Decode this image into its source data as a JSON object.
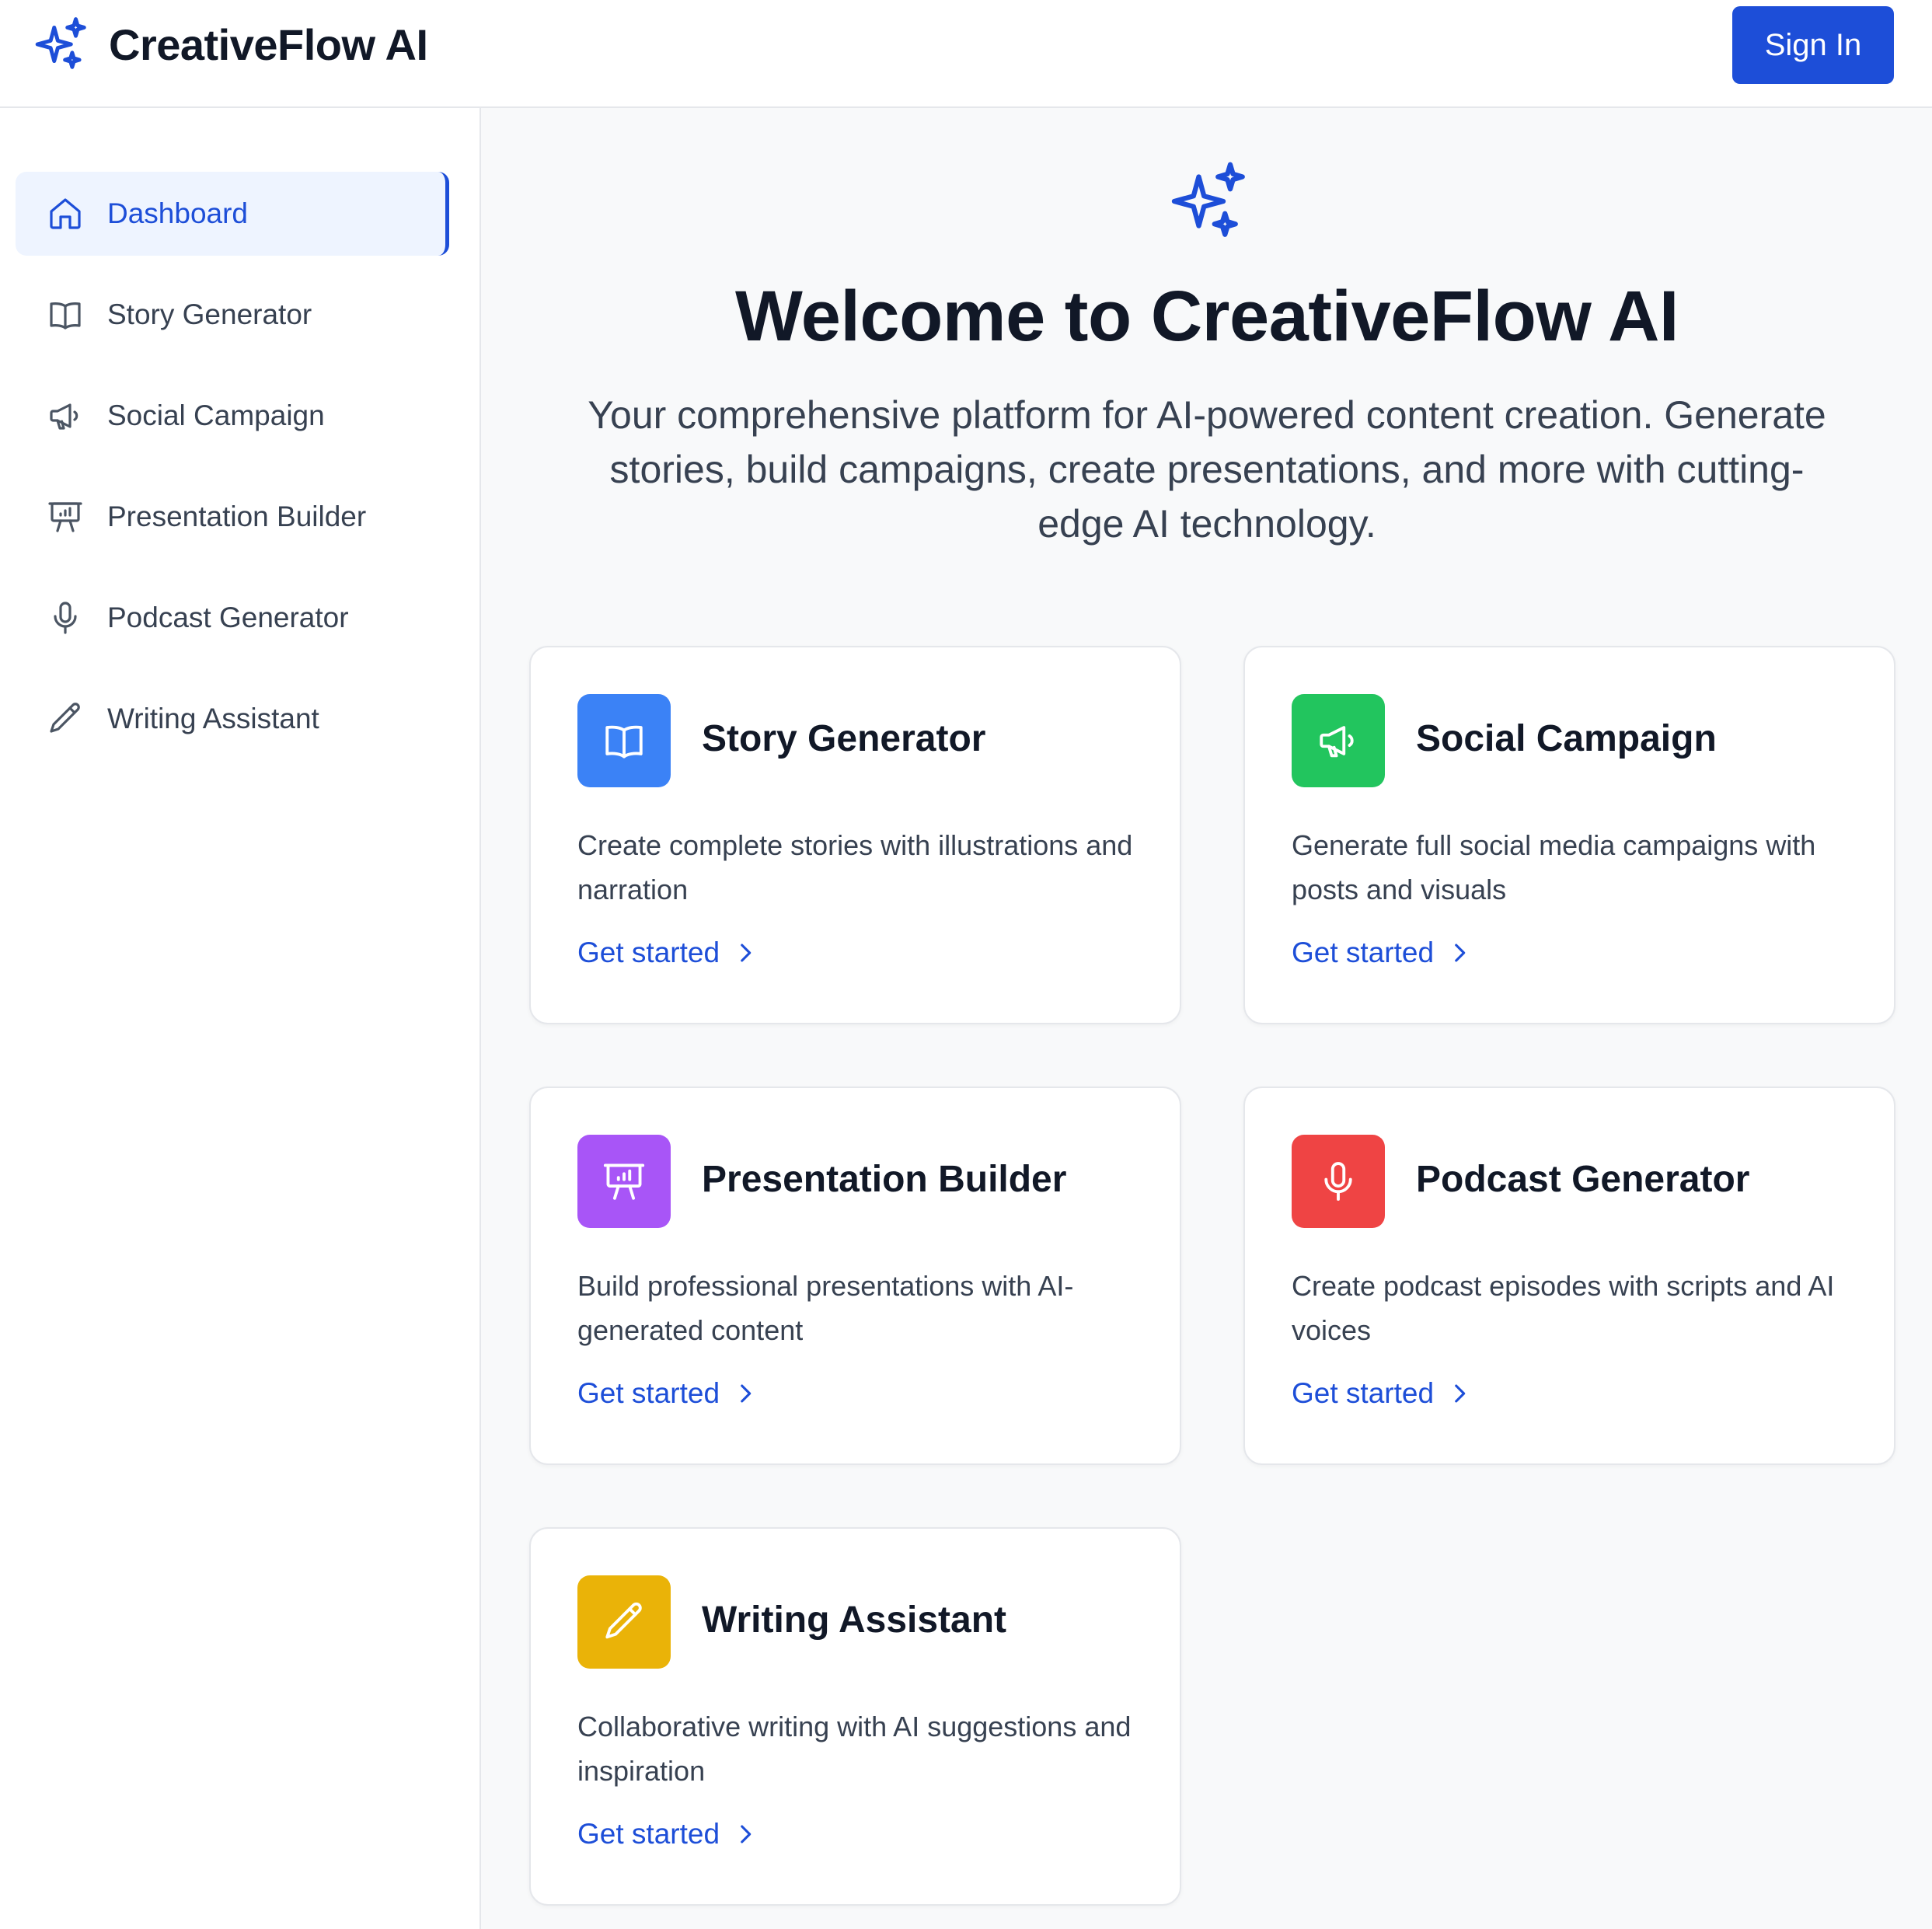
{
  "header": {
    "brand": "CreativeFlow AI",
    "sign_in_label": "Sign In"
  },
  "sidebar": {
    "items": [
      {
        "label": "Dashboard",
        "icon": "home-icon",
        "active": true
      },
      {
        "label": "Story Generator",
        "icon": "book-icon",
        "active": false
      },
      {
        "label": "Social Campaign",
        "icon": "megaphone-icon",
        "active": false
      },
      {
        "label": "Presentation Builder",
        "icon": "presentation-icon",
        "active": false
      },
      {
        "label": "Podcast Generator",
        "icon": "mic-icon",
        "active": false
      },
      {
        "label": "Writing Assistant",
        "icon": "pencil-icon",
        "active": false
      }
    ]
  },
  "hero": {
    "icon": "sparkles-icon",
    "title": "Welcome to CreativeFlow AI",
    "subtitle": "Your comprehensive platform for AI-powered content creation. Generate stories, build campaigns, create presentations, and more with cutting-edge AI technology."
  },
  "cards": [
    {
      "title": "Story Generator",
      "description": "Create complete stories with illustrations and narration",
      "link": "Get started",
      "icon": "book-icon",
      "color": "#3b82f6"
    },
    {
      "title": "Social Campaign",
      "description": "Generate full social media campaigns with posts and visuals",
      "link": "Get started",
      "icon": "megaphone-icon",
      "color": "#22c55e"
    },
    {
      "title": "Presentation Builder",
      "description": "Build professional presentations with AI-generated content",
      "link": "Get started",
      "icon": "presentation-icon",
      "color": "#a855f7"
    },
    {
      "title": "Podcast Generator",
      "description": "Create podcast episodes with scripts and AI voices",
      "link": "Get started",
      "icon": "mic-icon",
      "color": "#ef4444"
    },
    {
      "title": "Writing Assistant",
      "description": "Collaborative writing with AI suggestions and inspiration",
      "link": "Get started",
      "icon": "pencil-icon",
      "color": "#eab308"
    }
  ],
  "theme": {
    "accent": "#1d4ed8"
  }
}
